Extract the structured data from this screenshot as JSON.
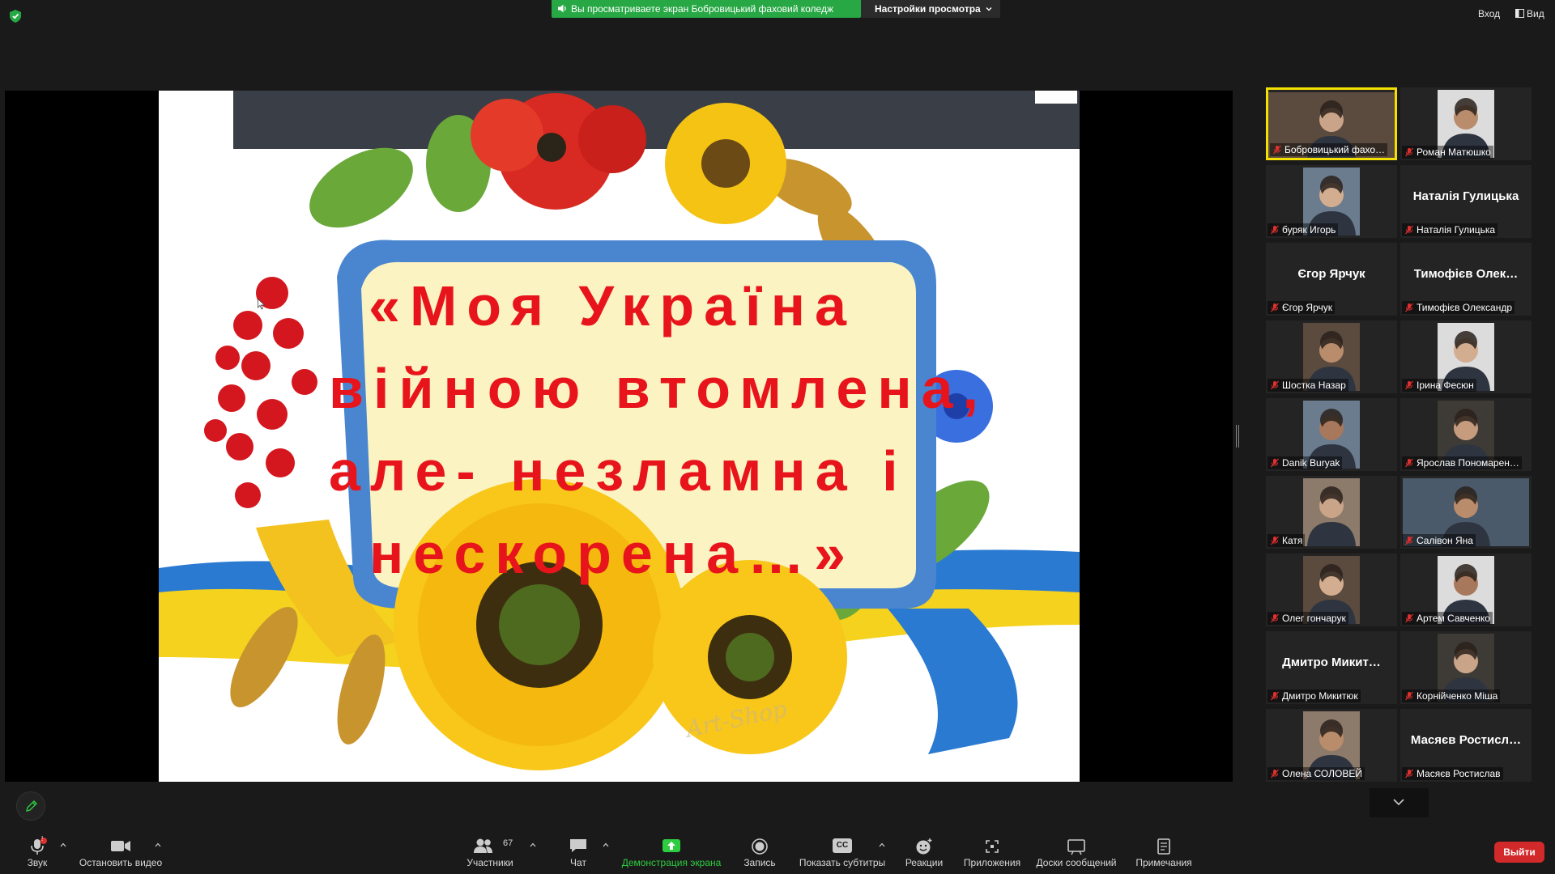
{
  "top": {
    "sharing_banner": "Вы просматриваете экран Бобровицький фаховий коледж",
    "view_options": "Настройки просмотра",
    "enter_label": "Вход",
    "view_label": "Вид"
  },
  "slide": {
    "lines": [
      "«Моя Україна",
      "війною втомлена,",
      "але- незламна і",
      "нескорена…»"
    ],
    "watermark": "Art-Shop"
  },
  "participants": [
    {
      "name": "Бобровицький фахо…",
      "big": "",
      "video": true,
      "active": true
    },
    {
      "name": "Роман Матюшко",
      "big": "",
      "video": true,
      "active": false
    },
    {
      "name": "буряк Игорь",
      "big": "",
      "video": true,
      "active": false
    },
    {
      "name": "Наталія Гулицька",
      "big": "Наталія Гулицька",
      "video": false,
      "active": false
    },
    {
      "name": "Єгор Ярчук",
      "big": "Єгор Ярчук",
      "video": false,
      "active": false
    },
    {
      "name": "Тимофієв Олександр",
      "big": "Тимофієв Олек…",
      "video": false,
      "active": false
    },
    {
      "name": "Шостка Назар",
      "big": "",
      "video": true,
      "active": false
    },
    {
      "name": "Ірина Фесюн",
      "big": "",
      "video": true,
      "active": false
    },
    {
      "name": "Danik Buryak",
      "big": "",
      "video": true,
      "active": false
    },
    {
      "name": "Ярослав Пономарен…",
      "big": "",
      "video": true,
      "active": false
    },
    {
      "name": "Катя",
      "big": "",
      "video": true,
      "active": false
    },
    {
      "name": "Салівон Яна",
      "big": "",
      "video": true,
      "active": false
    },
    {
      "name": "Олег гончарук",
      "big": "",
      "video": true,
      "active": false
    },
    {
      "name": "Артем Савченко",
      "big": "",
      "video": true,
      "active": false
    },
    {
      "name": "Дмитро Микитюк",
      "big": "Дмитро Микит…",
      "video": false,
      "active": false
    },
    {
      "name": "Корнійченко Міша",
      "big": "",
      "video": true,
      "active": false
    },
    {
      "name": "Олена СОЛОВЕЙ",
      "big": "",
      "video": true,
      "active": false
    },
    {
      "name": "Масяєв Ростислав",
      "big": "Масяєв Ростисл…",
      "video": false,
      "active": false
    }
  ],
  "toolbar": {
    "audio": "Звук",
    "audio_badge": "!",
    "video": "Остановить видео",
    "participants": "Участники",
    "participants_count": "67",
    "chat": "Чат",
    "share": "Демонстрация экрана",
    "record": "Запись",
    "captions": "Показать субтитры",
    "captions_icon_text": "CC",
    "reactions": "Реакции",
    "apps": "Приложения",
    "whiteboards": "Доски сообщений",
    "notes": "Примечания",
    "leave": "Выйти"
  },
  "colors": {
    "banner_green": "#27a844",
    "active_border": "#f3e000",
    "leave_red": "#d2292a",
    "share_green": "#2ecc40",
    "slide_text_red": "#e8141b"
  }
}
